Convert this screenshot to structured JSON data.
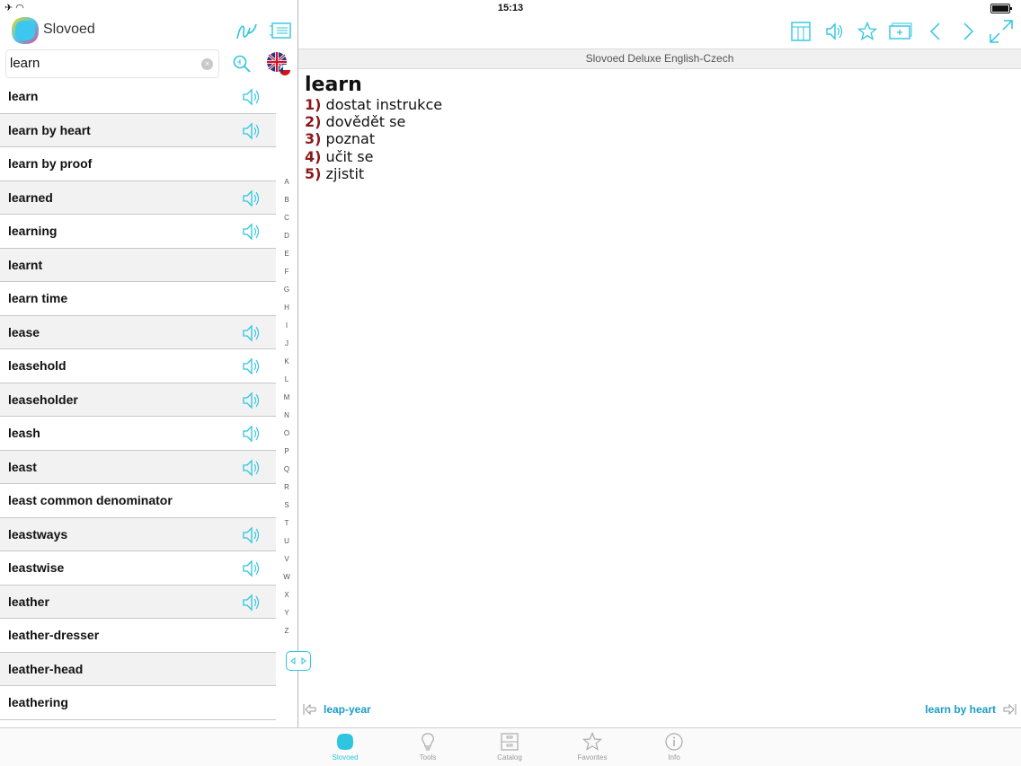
{
  "status": {
    "time": "15:13"
  },
  "app": {
    "name": "Slovoed"
  },
  "search": {
    "value": "learn"
  },
  "words": [
    {
      "label": "learn",
      "sound": true
    },
    {
      "label": "learn by heart",
      "sound": true
    },
    {
      "label": "learn by proof",
      "sound": false
    },
    {
      "label": "learned",
      "sound": true
    },
    {
      "label": "learning",
      "sound": true
    },
    {
      "label": "learnt",
      "sound": false
    },
    {
      "label": "learn time",
      "sound": false
    },
    {
      "label": "lease",
      "sound": true
    },
    {
      "label": "leasehold",
      "sound": true
    },
    {
      "label": "leaseholder",
      "sound": true
    },
    {
      "label": "leash",
      "sound": true
    },
    {
      "label": "least",
      "sound": true
    },
    {
      "label": "least common denominator",
      "sound": false
    },
    {
      "label": "leastways",
      "sound": true
    },
    {
      "label": "leastwise",
      "sound": true
    },
    {
      "label": "leather",
      "sound": true
    },
    {
      "label": "leather-dresser",
      "sound": false
    },
    {
      "label": "leather-head",
      "sound": false
    },
    {
      "label": "leathering",
      "sound": false
    }
  ],
  "alphabet": [
    "A",
    "B",
    "C",
    "D",
    "E",
    "F",
    "G",
    "H",
    "I",
    "J",
    "K",
    "L",
    "M",
    "N",
    "O",
    "P",
    "Q",
    "R",
    "S",
    "T",
    "U",
    "V",
    "W",
    "X",
    "Y",
    "Z"
  ],
  "dictionary_title": "Slovoed Deluxe English-Czech",
  "entry": {
    "headword": "learn",
    "meanings": [
      {
        "num": "1)",
        "text": "dostat instrukce"
      },
      {
        "num": "2)",
        "text": "dovědět se"
      },
      {
        "num": "3)",
        "text": "poznat"
      },
      {
        "num": "4)",
        "text": "učit se"
      },
      {
        "num": "5)",
        "text": "zjistit"
      }
    ]
  },
  "nav": {
    "prev": "leap-year",
    "next": "learn by heart"
  },
  "tabs": [
    {
      "label": "Slovoed",
      "icon": "slovoed-icon",
      "active": true
    },
    {
      "label": "Tools",
      "icon": "lightbulb-icon",
      "active": false
    },
    {
      "label": "Catalog",
      "icon": "catalog-icon",
      "active": false
    },
    {
      "label": "Favorites",
      "icon": "star-icon",
      "active": false
    },
    {
      "label": "Info",
      "icon": "info-icon",
      "active": false
    }
  ],
  "colors": {
    "accent": "#2ec5e0",
    "number": "#8a1a1a",
    "link": "#1a9cc8"
  }
}
